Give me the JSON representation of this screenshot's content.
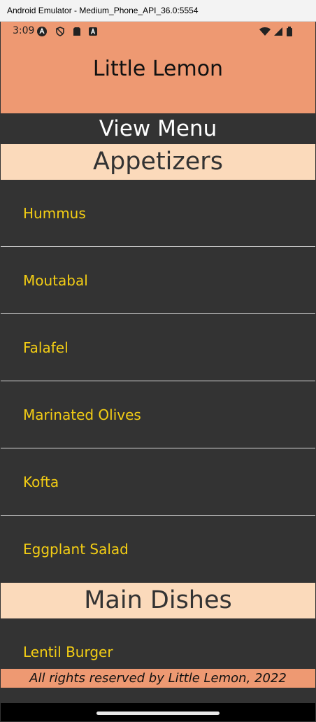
{
  "window": {
    "title": "Android Emulator - Medium_Phone_API_36.0:5554"
  },
  "status_bar": {
    "time": "3:09",
    "left_icons": [
      "android-studio-icon",
      "shield-icon",
      "sim-card-icon",
      "text-a-icon"
    ],
    "right_icons": [
      "wifi-icon",
      "cell-signal-icon",
      "battery-icon"
    ]
  },
  "header": {
    "title": "Little Lemon",
    "background": "#EE9972"
  },
  "menu": {
    "heading": "View Menu",
    "sections": [
      {
        "title": "Appetizers",
        "items": [
          "Hummus",
          "Moutabal",
          "Falafel",
          "Marinated Olives",
          "Kofta",
          "Eggplant Salad"
        ]
      },
      {
        "title": "Main Dishes",
        "items": [
          "Lentil Burger"
        ]
      }
    ]
  },
  "footer": {
    "text": "All rights reserved by Little Lemon, 2022"
  },
  "colors": {
    "background": "#333333",
    "item_text": "#F4CE14",
    "section_background": "#FBDABB",
    "accent": "#EE9972"
  }
}
